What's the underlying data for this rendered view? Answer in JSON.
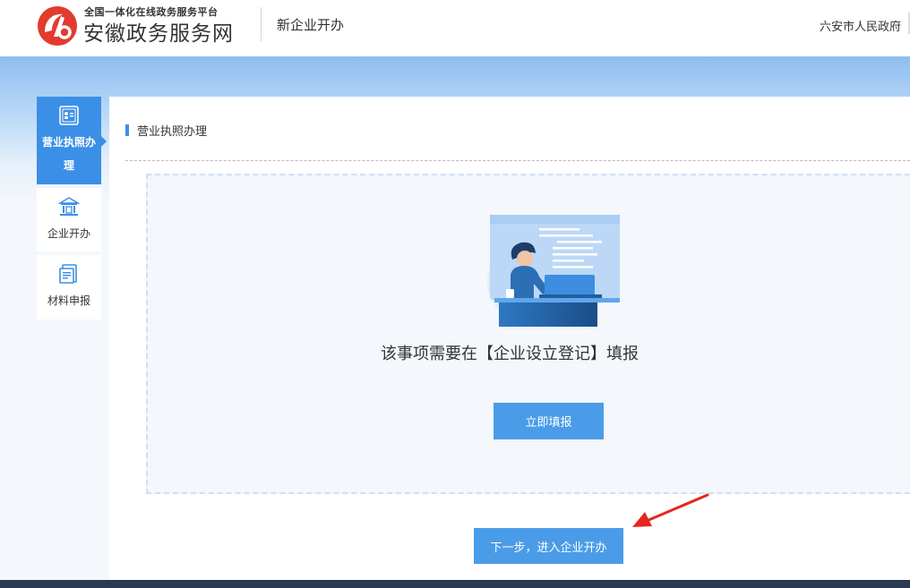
{
  "header": {
    "subtitle": "全国一体化在线政务服务平台",
    "title": "安徽政务服务网",
    "section": "新企业开办",
    "region": "六安市人民政府"
  },
  "sidebar": {
    "items": [
      {
        "label": "营业执照办理",
        "icon": "license-icon",
        "active": true
      },
      {
        "label": "企业开办",
        "icon": "building-icon",
        "active": false
      },
      {
        "label": "材料申报",
        "icon": "document-icon",
        "active": false
      }
    ]
  },
  "main": {
    "section_title": "营业执照办理",
    "notice": "该事项需要在【企业设立登记】填报",
    "fill_button": "立即填报",
    "next_button": "下一步，进入企业开办"
  },
  "colors": {
    "accent": "#3c8fe6",
    "button": "#4a9ce8",
    "brand_red": "#e23b2e",
    "annotation_arrow": "#e5261f"
  }
}
